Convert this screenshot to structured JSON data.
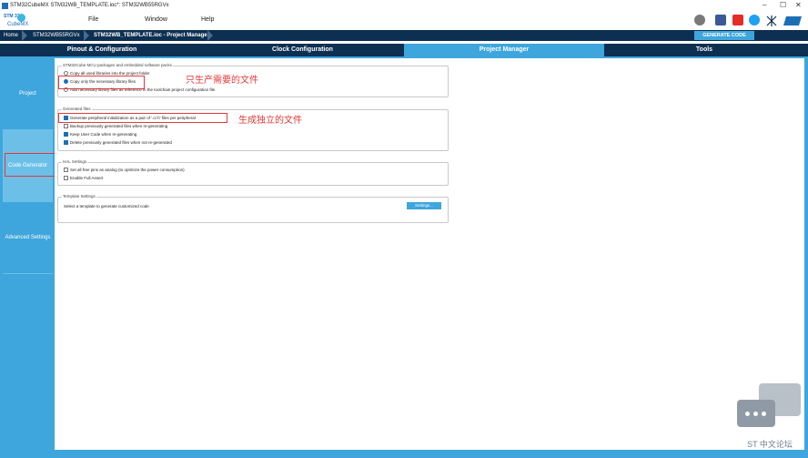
{
  "window": {
    "title": "STM32CubeMX STM32WB_TEMPLATE.ioc*: STM32WB55RGVx",
    "minimize": "–",
    "maximize": "☐",
    "close": "✕"
  },
  "logo": {
    "line1": "STM 32",
    "line2": "CubeMX"
  },
  "menu": {
    "file": "File",
    "window": "Window",
    "help": "Help"
  },
  "social_icons": [
    "anniversary-icon",
    "facebook-icon",
    "youtube-icon",
    "twitter-icon",
    "network-icon",
    "st-logo-icon"
  ],
  "breadcrumb": {
    "home": "Home",
    "mcu": "STM32WB55RGVx",
    "current": "STM32WB_TEMPLATE.ioc - Project Manager"
  },
  "generate_button": "GENERATE CODE",
  "tabs": [
    {
      "label": "Pinout & Configuration",
      "active": false
    },
    {
      "label": "Clock Configuration",
      "active": false
    },
    {
      "label": "Project Manager",
      "active": true
    },
    {
      "label": "Tools",
      "active": false
    }
  ],
  "sidebar": [
    {
      "label": "Project",
      "selected": false
    },
    {
      "label": "Code Generator",
      "selected": true
    },
    {
      "label": "Advanced Settings",
      "selected": false
    }
  ],
  "packages": {
    "legend": "STM32Cube MCU packages and embedded software packs",
    "options": [
      {
        "label": "Copy all used libraries into the project folder",
        "checked": false
      },
      {
        "label": "Copy only the necessary library files",
        "checked": true
      },
      {
        "label": "Add necessary library files as reference in the toolchain project configuration file",
        "checked": false
      }
    ]
  },
  "generated": {
    "legend": "Generated files",
    "options": [
      {
        "label": "Generate peripheral initialization as a pair of '.c/.h' files per peripheral",
        "checked": true
      },
      {
        "label": "Backup previously generated files when re-generating",
        "checked": false
      },
      {
        "label": "Keep User Code when re-generating",
        "checked": true
      },
      {
        "label": "Delete previously generated files when not re-generated",
        "checked": true
      }
    ]
  },
  "hal": {
    "legend": "HAL Settings",
    "options": [
      {
        "label": "Set all free pins as analog (to optimize the power consumption)",
        "checked": false
      },
      {
        "label": "Enable Full Assert",
        "checked": false
      }
    ]
  },
  "template": {
    "legend": "Template Settings",
    "description": "Select a template to generate customized code",
    "button": "Settings..."
  },
  "annotations": {
    "copy_necessary": "只生产需要的文件",
    "separate_files": "生成独立的文件"
  },
  "watermark": "ST 中文论坛",
  "colors": {
    "navy": "#0d2f51",
    "accent": "#3ea6dc",
    "annotation": "#e23a3a"
  }
}
